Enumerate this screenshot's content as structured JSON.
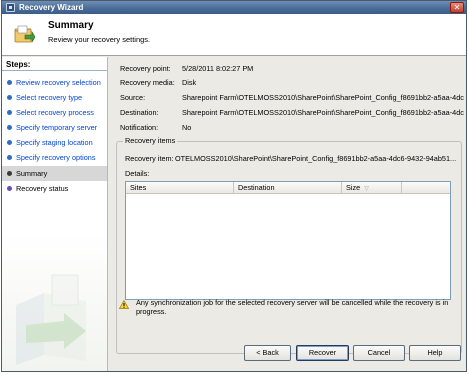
{
  "window": {
    "title": "Recovery Wizard",
    "close_glyph": "✕"
  },
  "header": {
    "title": "Summary",
    "subtitle": "Review your recovery settings.",
    "icon": "recovery-wizard-icon"
  },
  "sidebar": {
    "steps_label": "Steps:",
    "steps": [
      {
        "label": "Review recovery selection",
        "state": "done"
      },
      {
        "label": "Select recovery type",
        "state": "done"
      },
      {
        "label": "Select recovery process",
        "state": "done"
      },
      {
        "label": "Specify temporary server",
        "state": "done"
      },
      {
        "label": "Specify staging location",
        "state": "done"
      },
      {
        "label": "Specify recovery options",
        "state": "done"
      },
      {
        "label": "Summary",
        "state": "current"
      },
      {
        "label": "Recovery status",
        "state": "future"
      }
    ]
  },
  "summary": {
    "recovery_point_label": "Recovery point:",
    "recovery_point_value": "5/28/2011 8:02:27 PM",
    "recovery_media_label": "Recovery media:",
    "recovery_media_value": "Disk",
    "source_label": "Source:",
    "source_value": "Sharepoint Farm\\OTELMOSS2010\\SharePoint\\SharePoint_Config_f8691bb2-a5aa-4dc6-9432-94ab51...",
    "destination_label": "Destination:",
    "destination_value": "Sharepoint Farm\\OTELMOSS2010\\SharePoint\\SharePoint_Config_f8691bb2-a5aa-4dc6-9432-94ab51...",
    "notification_label": "Notification:",
    "notification_value": "No"
  },
  "recovery_items": {
    "group_title": "Recovery items",
    "item_label": "Recovery item:",
    "item_value": "OTELMOSS2010\\SharePoint\\SharePoint_Config_f8691bb2-a5aa-4dc6-9432-94ab51...",
    "details_label": "Details:",
    "columns": [
      "Sites",
      "Destination",
      "Size"
    ],
    "sort_glyph": "▽",
    "rows": []
  },
  "warning": {
    "icon": "warning-icon",
    "text": "Any synchronization job for the selected recovery server will be cancelled while the recovery is in progress."
  },
  "buttons": {
    "back": "< Back",
    "recover": "Recover",
    "cancel": "Cancel",
    "help": "Help"
  },
  "colors": {
    "link": "#0046d5",
    "titlebar": "#4b6d97",
    "current_step_bg": "#d7d7d7"
  }
}
